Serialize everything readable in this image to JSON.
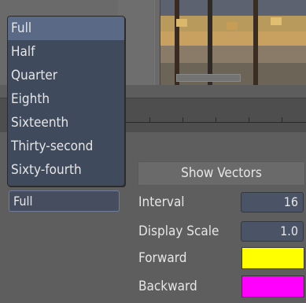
{
  "menu": {
    "items": [
      "Full",
      "Half",
      "Quarter",
      "Eighth",
      "Sixteenth",
      "Thirty-second",
      "Sixty-fourth"
    ],
    "selected_index": 0
  },
  "selector": {
    "value": "Full"
  },
  "vectors": {
    "show_label": "Show Vectors",
    "interval_label": "Interval",
    "interval_value": "16",
    "display_scale_label": "Display Scale",
    "display_scale_value": "1.0",
    "forward_label": "Forward",
    "forward_color": "#ffff00",
    "backward_label": "Backward",
    "backward_color": "#ff00ff"
  }
}
